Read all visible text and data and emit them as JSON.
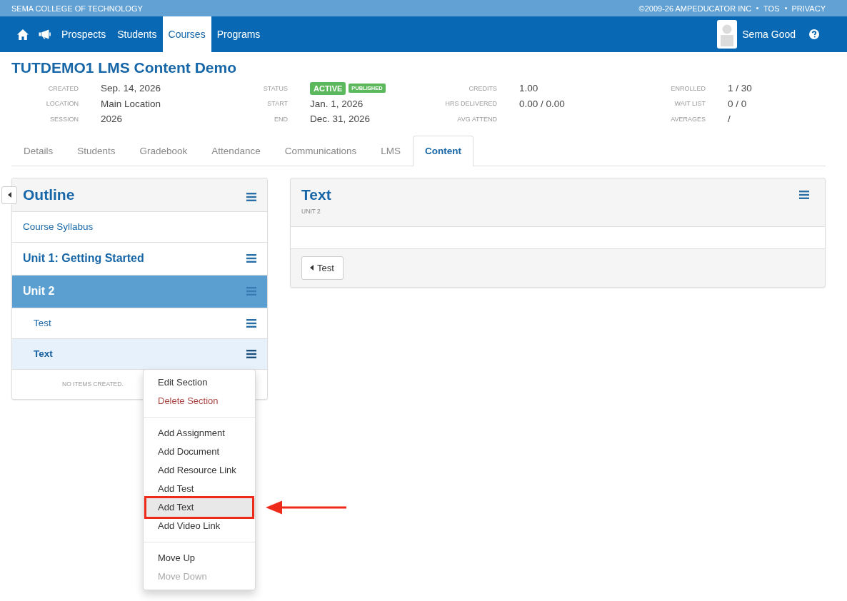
{
  "top_strip": {
    "school": "SEMA COLLEGE OF TECHNOLOGY",
    "copyright": "©2009-26 AMPEDUCATOR INC",
    "links": [
      "TOS",
      "PRIVACY"
    ]
  },
  "nav": {
    "items": [
      {
        "label": "Prospects",
        "selected": false
      },
      {
        "label": "Students",
        "selected": false
      },
      {
        "label": "Courses",
        "selected": true
      },
      {
        "label": "Programs",
        "selected": false
      }
    ],
    "user": {
      "name": "Sema Good"
    }
  },
  "course": {
    "title": "TUTDEMO1 LMS Content Demo",
    "field_groups": [
      {
        "rows": [
          {
            "label": "CREATED",
            "value": "Sep. 14, 2026"
          },
          {
            "label": "LOCATION",
            "value": "Main Location"
          },
          {
            "label": "SESSION",
            "value": "2026"
          }
        ]
      },
      {
        "rows": [
          {
            "label": "STATUS",
            "badges": [
              {
                "text": "ACTIVE",
                "kind": "status"
              },
              {
                "text": "PUBLISHED",
                "kind": "flag"
              }
            ]
          },
          {
            "label": "START",
            "value": "Jan. 1, 2026"
          },
          {
            "label": "END",
            "value": "Dec. 31, 2026"
          }
        ]
      },
      {
        "rows": [
          {
            "label": "CREDITS",
            "value": "1.00"
          },
          {
            "label": "HRS DELIVERED",
            "value": "0.00 / 0.00"
          },
          {
            "label": "AVG ATTEND"
          }
        ]
      },
      {
        "rows": [
          {
            "label": "ENROLLED",
            "value": "1 / 30"
          },
          {
            "label": "WAIT LIST",
            "value": "0 / 0"
          },
          {
            "label": "AVERAGES",
            "value": "/"
          }
        ]
      }
    ]
  },
  "tabs": [
    {
      "label": "Details",
      "selected": false
    },
    {
      "label": "Students",
      "selected": false
    },
    {
      "label": "Gradebook",
      "selected": false
    },
    {
      "label": "Attendance",
      "selected": false
    },
    {
      "label": "Communications",
      "selected": false
    },
    {
      "label": "LMS",
      "selected": false
    },
    {
      "label": "Content",
      "selected": true
    }
  ],
  "outline": {
    "title": "Outline",
    "items": [
      {
        "kind": "page",
        "label": "Course Syllabus",
        "selected": false,
        "menu": false
      },
      {
        "kind": "section",
        "label": "Unit 1: Getting Started",
        "selected": false,
        "menu": true
      },
      {
        "kind": "section",
        "label": "Unit 2",
        "selected": true,
        "menu": true,
        "children": [
          {
            "kind": "item",
            "label": "Test",
            "selected": false,
            "menu": true,
            "menu_open": false
          },
          {
            "kind": "item",
            "label": "Text",
            "selected": true,
            "menu": true,
            "menu_open": true
          }
        ]
      }
    ],
    "empty_note": "NO ITEMS CREATED."
  },
  "context_menu": {
    "groups": [
      {
        "items": [
          {
            "label": "Edit Section",
            "kind": "action",
            "disabled": false,
            "hovered": false,
            "annotated": false
          },
          {
            "label": "Delete Section",
            "kind": "danger",
            "disabled": false,
            "hovered": false,
            "annotated": false
          }
        ]
      },
      {
        "items": [
          {
            "label": "Add Assignment",
            "kind": "action",
            "disabled": false,
            "hovered": false,
            "annotated": false
          },
          {
            "label": "Add Document",
            "kind": "action",
            "disabled": false,
            "hovered": false,
            "annotated": false
          },
          {
            "label": "Add Resource Link",
            "kind": "action",
            "disabled": false,
            "hovered": false,
            "annotated": false
          },
          {
            "label": "Add Test",
            "kind": "action",
            "disabled": false,
            "hovered": false,
            "annotated": false
          },
          {
            "label": "Add Text",
            "kind": "action",
            "disabled": false,
            "hovered": true,
            "annotated": true
          },
          {
            "label": "Add Video Link",
            "kind": "action",
            "disabled": false,
            "hovered": false,
            "annotated": false
          }
        ]
      },
      {
        "items": [
          {
            "label": "Move Up",
            "kind": "action",
            "disabled": false,
            "hovered": false,
            "annotated": false
          },
          {
            "label": "Move Down",
            "kind": "action",
            "disabled": true,
            "hovered": false,
            "annotated": false
          }
        ]
      }
    ]
  },
  "detail": {
    "title": "Text",
    "subtitle": "UNIT 2",
    "back_button": {
      "label": "Test"
    }
  }
}
